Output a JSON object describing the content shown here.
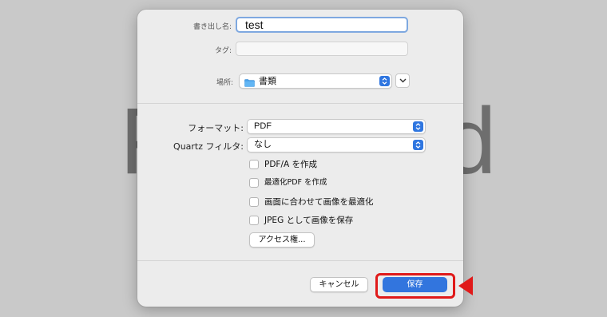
{
  "background": {
    "left_letter": "P",
    "right_letter": "d"
  },
  "dialog": {
    "export_as_label": "書き出し名:",
    "filename_value": "test",
    "tags_label": "タグ:",
    "tags_value": "",
    "location_label": "場所:",
    "location_value": "書類",
    "format_label": "フォーマット:",
    "format_value": "PDF",
    "quartz_filter_label": "Quartz フィルタ:",
    "quartz_filter_value": "なし",
    "options": [
      {
        "label": "PDF/A を作成",
        "checked": false
      },
      {
        "label": "最適化PDF を作成",
        "checked": false
      },
      {
        "label": "画面に合わせて画像を最適化",
        "checked": false
      },
      {
        "label": "JPEG として画像を保存",
        "checked": false
      }
    ],
    "access_button": "アクセス権...",
    "cancel_button": "キャンセル",
    "save_button": "保存"
  },
  "colors": {
    "accent": "#3275de",
    "highlight": "#e01a1a"
  }
}
